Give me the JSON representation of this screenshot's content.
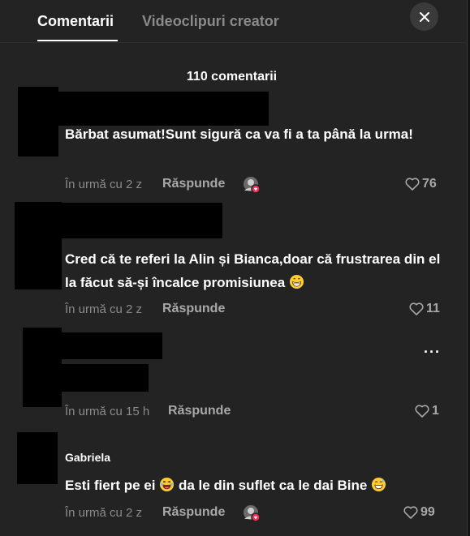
{
  "tabs": {
    "comments_label": "Comentarii",
    "creator_videos_label": "Videoclipuri creator"
  },
  "close_icon": "close-icon",
  "comment_count": "110 comentarii",
  "reply_label": "Răspunde",
  "colors": {
    "background": "#232323",
    "text_primary": "#ffffff",
    "text_secondary": "#8a8a8a",
    "redaction": "#000000",
    "creator_badge": "#fe2c55"
  },
  "comments": [
    {
      "text": "Bărbat asumat!Sunt sigură ca va fi a ta până la urma!",
      "time": "În urmă cu 2 z",
      "likes": "76",
      "creator_liked": true
    },
    {
      "text": "Cred că te referi la Alin și Bianca,doar că frustrarea din el la făcut să-și încalce promisiunea",
      "time": "În urmă cu 2 z",
      "likes": "11",
      "creator_liked": false
    },
    {
      "text": "",
      "time": "În urmă cu 15 h",
      "likes": "1",
      "creator_liked": false
    },
    {
      "author": "Gabriela",
      "text_part1": "Esti fiert pe ei",
      "text_part2": "da le din suflet ca le dai Bine",
      "time": "În urmă cu 2 z",
      "likes": "99",
      "creator_liked": true
    }
  ]
}
